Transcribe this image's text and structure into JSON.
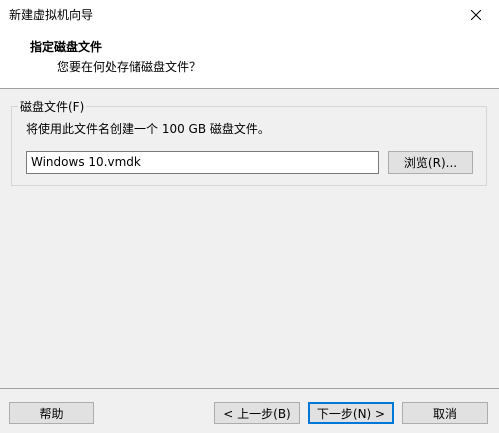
{
  "window": {
    "title": "新建虚拟机向导"
  },
  "header": {
    "heading": "指定磁盘文件",
    "subheading": "您要在何处存储磁盘文件？"
  },
  "disk_file": {
    "group_label": "磁盘文件(F)",
    "description": "将使用此文件名创建一个 100 GB 磁盘文件。",
    "filename_value": "Windows 10.vmdk",
    "browse_label": "浏览(R)..."
  },
  "footer": {
    "help_label": "帮助",
    "back_label": "< 上一步(B)",
    "next_label": "下一步(N) >",
    "cancel_label": "取消"
  },
  "icons": {
    "close": "close-icon"
  }
}
